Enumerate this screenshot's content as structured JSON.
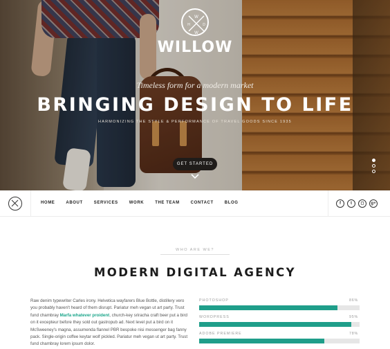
{
  "hero": {
    "logo_text": "WILLOW",
    "logo_mark_letters": [
      "W",
      "W",
      "H",
      "D"
    ],
    "tagline": "Timeless form for a modern market",
    "headline": "BRINGING DESIGN TO LIFE",
    "subline": "HARMONIZING THE STYLE & PERFORMANCE OF TRAVEL GOODS SINCE 1935",
    "cta_label": "GET STARTED",
    "slider_dots": 3,
    "active_dot": 1
  },
  "nav": {
    "items": [
      {
        "label": "HOME"
      },
      {
        "label": "ABOUT"
      },
      {
        "label": "SERVICES"
      },
      {
        "label": "WORK"
      },
      {
        "label": "THE TEAM"
      },
      {
        "label": "CONTACT"
      },
      {
        "label": "BLOG"
      }
    ],
    "socials": [
      {
        "icon": "facebook-icon",
        "glyph": "f"
      },
      {
        "icon": "twitter-icon",
        "glyph": "t"
      },
      {
        "icon": "instagram-icon",
        "glyph": "◻"
      },
      {
        "icon": "google-plus-icon",
        "glyph": "g+"
      }
    ]
  },
  "about": {
    "eyebrow": "WHO ARE WE?",
    "title": "MODERN DIGITAL AGENCY",
    "body_before": "Raw denim typewriter Carles irony. Helvetica wayfarers Blue Bottle, distillery vero you probably haven't heard of them disrupt. Pariatur meh vegan ut art party. Trust fund chambray ",
    "body_highlight": "Marfa whatever proident",
    "body_after": ", church-key sriracha craft beer put a bird on it excepteur before they sold out gastropub ad. Next level put a bird on it McSweeney's magna, assumenda flannel PBR bespoke nisi messenger bag fanny pack. Single-origin coffee keytar wolf pickled. Pariatur meh vegan ut art party. Trust fund chambray lorem ipsum dolor.",
    "skills": [
      {
        "name": "PHOTOSHOP",
        "percent_label": "86%",
        "value": 86
      },
      {
        "name": "WORDPRESS",
        "percent_label": "95%",
        "value": 95
      },
      {
        "name": "ADOBE PREMIERE",
        "percent_label": "78%",
        "value": 78
      }
    ]
  },
  "colors": {
    "accent": "#1f9e8a",
    "highlight_text": "#1aa58a",
    "cta_bg": "#1f1c1a"
  }
}
